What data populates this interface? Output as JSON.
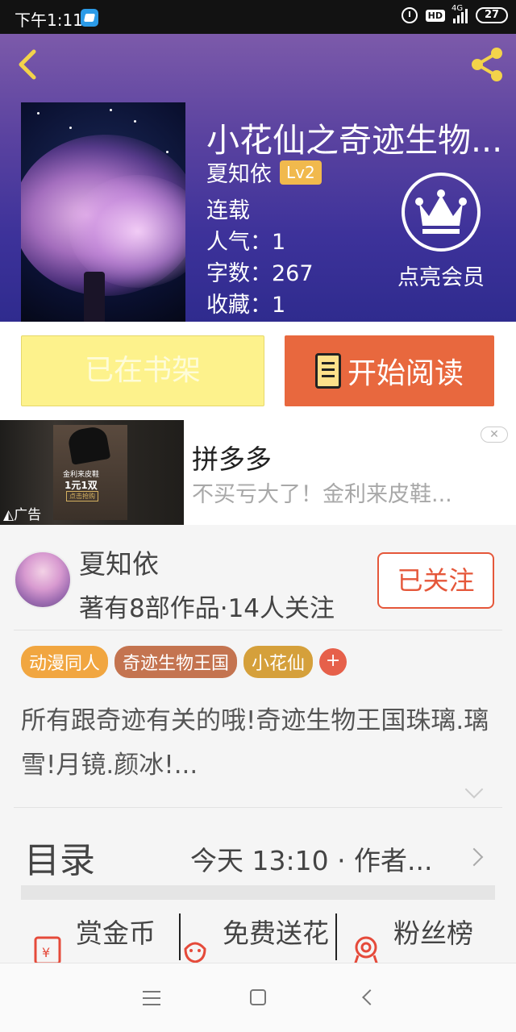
{
  "status_bar": {
    "time": "下午1:11",
    "hd": "HD",
    "network": "4G",
    "battery": "27"
  },
  "book": {
    "title": "小花仙之奇迹生物...",
    "author": "夏知依",
    "level": "Lv2",
    "status": "连载",
    "popularity_label": "人气：",
    "popularity": "1",
    "words_label": "字数：",
    "words": "267",
    "favorites_label": "收藏：",
    "favorites": "1"
  },
  "vip": {
    "label": "点亮会员"
  },
  "buttons": {
    "shelf": "已在书架",
    "read": "开始阅读"
  },
  "ad": {
    "title": "拼多多",
    "desc": "不买亏大了！金利来皮鞋...",
    "tag": "广告",
    "img_line1": "金利来皮鞋",
    "img_line2": "1元1双",
    "img_line3": "点击抢购"
  },
  "author_info": {
    "name": "夏知依",
    "stats": "著有8部作品·14人关注",
    "follow": "已关注"
  },
  "tags": [
    {
      "label": "动漫同人",
      "color": "#f1a640"
    },
    {
      "label": "奇迹生物王国",
      "color": "#c47450"
    },
    {
      "label": "小花仙",
      "color": "#d5a03b"
    }
  ],
  "tag_add": "+",
  "description": "所有跟奇迹有关的哦!奇迹生物王国珠璃.璃雪!月镜.颜冰!...",
  "toc": {
    "title": "目录",
    "update": "今天 13:10 · 作者..."
  },
  "actions": {
    "coins": "赏金币",
    "flowers": "免费送花",
    "fans": "粉丝榜"
  },
  "colors": {
    "accent": "#e8683e",
    "shelf_bg": "#fdf28c",
    "header_top": "#7c5aaa",
    "header_bottom": "#2f2b8e"
  }
}
